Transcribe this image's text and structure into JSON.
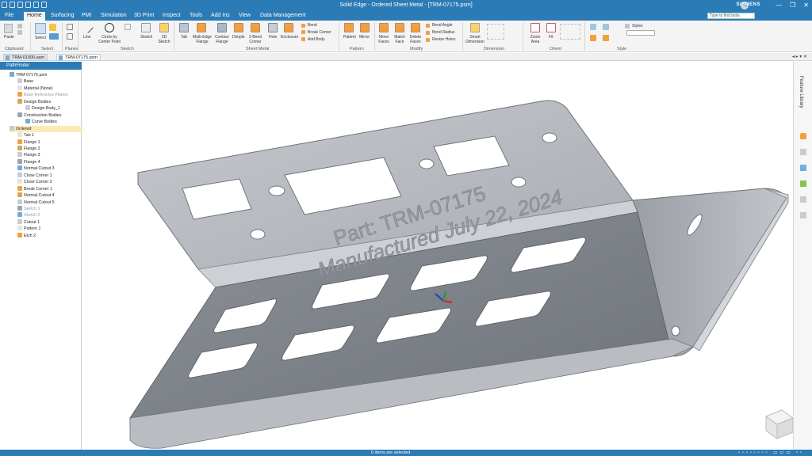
{
  "window": {
    "title": "Solid Edge - Ordered Sheet Metal - [TRM-07175.psm]",
    "brand": "SIEMENS",
    "avatar_initials": "KS",
    "controls": [
      "—",
      "❐",
      "✕"
    ]
  },
  "menu": {
    "tabs": [
      "File",
      "Home",
      "Surfacing",
      "PMI",
      "Simulation",
      "3D Print",
      "Inspect",
      "Tools",
      "Add Ins",
      "View",
      "Data Management"
    ],
    "active_tab": "Home",
    "search_placeholder": "Type to find tools"
  },
  "ribbon": {
    "clipboard": {
      "label": "Clipboard",
      "paste": "Paste"
    },
    "select": {
      "label": "Select",
      "button": "Select"
    },
    "planes": {
      "label": "Planes"
    },
    "sketch": {
      "label": "Sketch",
      "line": "Line",
      "circle": "Circle by Center Point",
      "sketch": "Sketch",
      "sketch3d": "3D Sketch"
    },
    "sheet_metal": {
      "label": "Sheet Metal",
      "tab": "Tab",
      "multi_edge": "Multi-Edge Flange",
      "contour": "Contour Flange",
      "dimple": "Dimple",
      "two_bend": "2-Bend Corner",
      "hole": "Hole",
      "enclosure": "Enclosure",
      "bend": "Bend",
      "break_corner": "Break Corner",
      "add_body": "Add Body"
    },
    "pattern": {
      "label": "Pattern",
      "pattern": "Pattern",
      "mirror": "Mirror"
    },
    "modify": {
      "label": "Modify",
      "move_faces": "Move Faces",
      "match_face": "Match Face",
      "delete_faces": "Delete Faces",
      "bend_angle": "Bend Angle",
      "bend_radius": "Bend Radius",
      "resize_holes": "Resize Holes"
    },
    "dimension": {
      "label": "Dimension",
      "smart_dimension": "Smart Dimension"
    },
    "orient": {
      "label": "Orient",
      "zoom_area": "Zoom Area",
      "fit": "Fit"
    },
    "style": {
      "label": "Style",
      "styles": "Styles"
    }
  },
  "doc_tabs": [
    "TRM-01000.asm",
    "TRM-07175.psm"
  ],
  "active_doc": "TRM-07175.psm",
  "pathfinder": {
    "title": "PathFinder",
    "items": [
      {
        "label": "TRM-07175.psm",
        "level": 0
      },
      {
        "label": "Base",
        "level": 1
      },
      {
        "label": "Material (None)",
        "level": 1
      },
      {
        "label": "Base Reference Planes",
        "level": 1
      },
      {
        "label": "Design Bodies",
        "level": 1
      },
      {
        "label": "Design Body_1",
        "level": 2
      },
      {
        "label": "Construction Bodies",
        "level": 1
      },
      {
        "label": "Curve Bodies",
        "level": 2
      },
      {
        "label": "Ordered",
        "level": 0
      },
      {
        "label": "Tab 1",
        "level": 1
      },
      {
        "label": "Flange 1",
        "level": 1
      },
      {
        "label": "Flange 2",
        "level": 1
      },
      {
        "label": "Flange 3",
        "level": 1
      },
      {
        "label": "Flange 4",
        "level": 1
      },
      {
        "label": "Normal Cutout 3",
        "level": 1
      },
      {
        "label": "Close Corner 1",
        "level": 1
      },
      {
        "label": "Close Corner 2",
        "level": 1
      },
      {
        "label": "Break Corner 1",
        "level": 1
      },
      {
        "label": "Normal Cutout 4",
        "level": 1
      },
      {
        "label": "Normal Cutout 5",
        "level": 1
      },
      {
        "label": "Sketch 1",
        "level": 1
      },
      {
        "label": "Sketch 2",
        "level": 1
      },
      {
        "label": "Cutout 1",
        "level": 1
      },
      {
        "label": "Pattern 1",
        "level": 1
      },
      {
        "label": "Etch 2",
        "level": 1
      }
    ]
  },
  "part": {
    "etch_line1": "Part: TRM-07175",
    "etch_line2": "Manufactured July 22, 2024"
  },
  "right_panel": {
    "feature_library": "Feature Library"
  },
  "status": {
    "items_selected": "0 items are selected"
  },
  "colors": {
    "accent": "#2b7bb6",
    "part_fill": "#b4b7bd",
    "part_shade": "#7d8188"
  }
}
